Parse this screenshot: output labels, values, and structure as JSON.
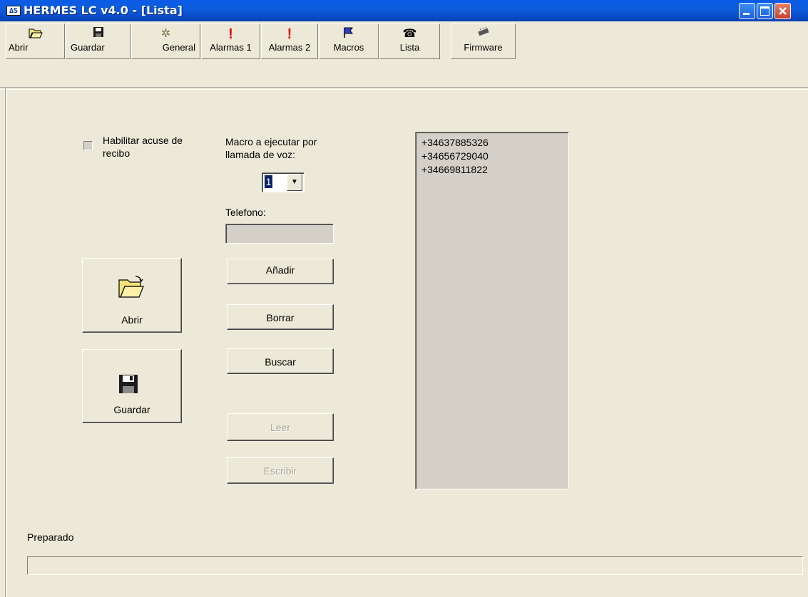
{
  "window": {
    "title": "HERMES LC v4.0 - [Lista]",
    "icon": "app-logo-icon",
    "accent": "#0a5be8"
  },
  "toolbar": {
    "items": [
      {
        "label": "Abrir",
        "icon": "open-folder-icon"
      },
      {
        "label": "Guardar",
        "icon": "floppy-disk-icon"
      },
      {
        "label": "General",
        "icon": "gears-icon"
      },
      {
        "label": "Alarmas 1",
        "icon": "exclamation-icon"
      },
      {
        "label": "Alarmas 2",
        "icon": "exclamation-icon"
      },
      {
        "label": "Macros",
        "icon": "flag-icon"
      },
      {
        "label": "Lista",
        "icon": "phone-icon"
      },
      {
        "label": "Firmware",
        "icon": "chip-icon"
      }
    ]
  },
  "form": {
    "ack_checkbox_label": "Habilitar acuse de recibo",
    "ack_checked": false,
    "macro_label": "Macro a ejecutar por llamada de voz:",
    "macro_value": "1",
    "phone_label": "Telefono:",
    "phone_value": "",
    "add_label": "Añadir",
    "delete_label": "Borrar",
    "search_label": "Buscar",
    "read_label": "Leer",
    "write_label": "Escribir",
    "open_label": "Abrir",
    "save_label": "Guardar"
  },
  "list": {
    "items": [
      "+34637885326",
      "+34656729040",
      "+34669811822"
    ]
  },
  "status": {
    "text": "Preparado"
  }
}
